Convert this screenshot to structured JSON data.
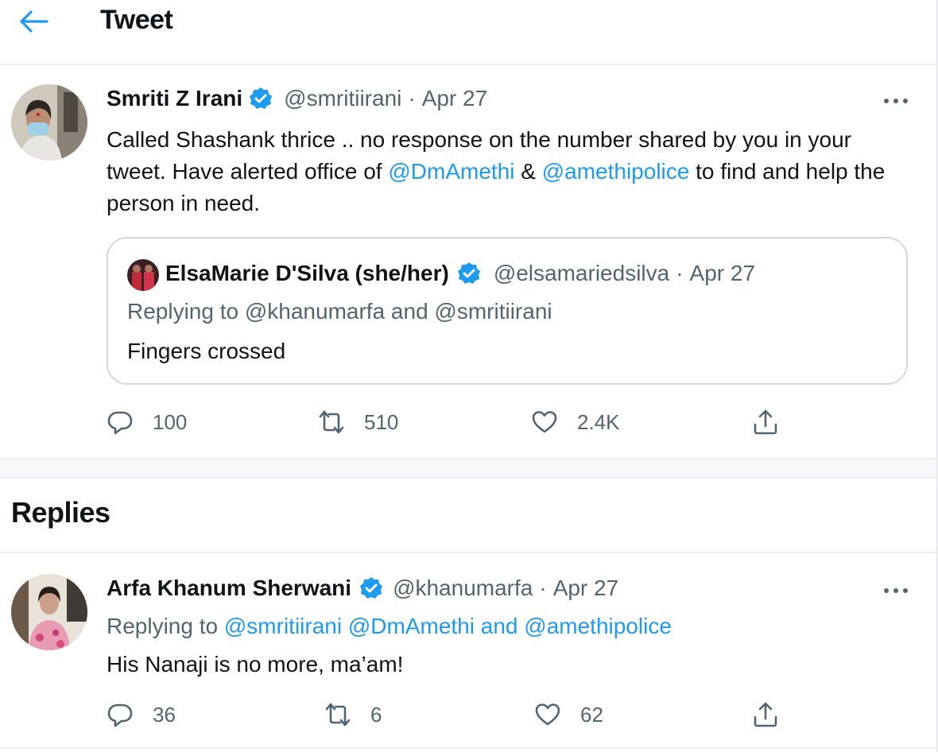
{
  "header": {
    "title": "Tweet"
  },
  "tweet": {
    "name": "Smriti Z Irani",
    "handle": "@smritiirani",
    "sep": "·",
    "date": "Apr 27",
    "text_1": "Called Shashank thrice .. no response on the number shared by you in your tweet. Have alerted office of ",
    "mention_1": "@DmAmethi",
    "text_2": " & ",
    "mention_2": "@amethipolice",
    "text_3": " to find and help the person in need.",
    "quote": {
      "name": "ElsaMarie D'Silva (she/her)",
      "handle": "@elsamariedsilva",
      "sep": "·",
      "date": "Apr 27",
      "replying": "Replying to @khanumarfa and @smritiirani",
      "text": "Fingers crossed"
    },
    "stats": {
      "replies": "100",
      "retweets": "510",
      "likes": "2.4K"
    }
  },
  "replies_section": {
    "title": "Replies"
  },
  "reply": {
    "name": "Arfa Khanum Sherwani",
    "handle": "@khanumarfa",
    "sep": "·",
    "date": "Apr 27",
    "replying_prefix": "Replying to ",
    "replying_m1": "@smritiirani",
    "replying_m2": "@DmAmethi",
    "replying_and": "and",
    "replying_m3": "@amethipolice",
    "text": "His Nanaji is no more, ma’am!",
    "stats": {
      "replies": "36",
      "retweets": "6",
      "likes": "62"
    }
  },
  "colors": {
    "accent": "#1d9bf0",
    "verified": "#1d9bf0",
    "muted": "#536471",
    "border": "#cfd9de"
  },
  "icons": [
    "back-arrow-icon",
    "verified-badge-icon",
    "more-icon",
    "reply-icon",
    "retweet-icon",
    "like-icon",
    "share-icon"
  ]
}
